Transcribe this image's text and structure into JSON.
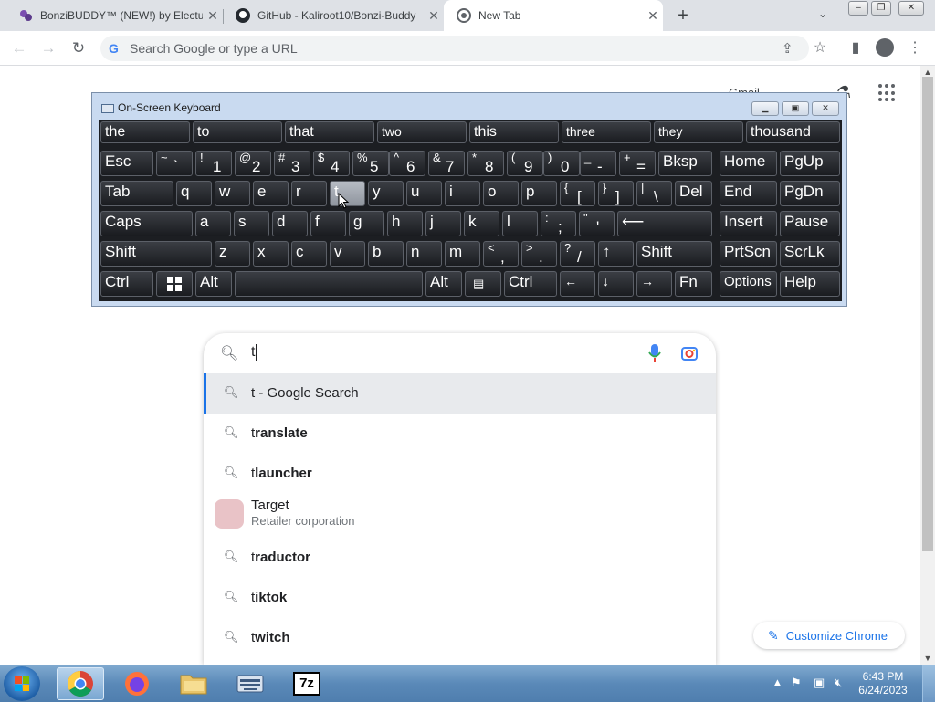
{
  "browser": {
    "tabs": [
      {
        "title": "BonziBUDDY™ (NEW!) by Electus"
      },
      {
        "title": "GitHub - Kaliroot10/Bonzi-Buddy"
      },
      {
        "title": "New Tab"
      }
    ],
    "new_tab": "+",
    "omnibox": {
      "placeholder": "Search Google or type a URL"
    }
  },
  "page": {
    "gmail_label": "Gmail",
    "search": {
      "query": "t",
      "suggestions": [
        {
          "text": "t - Google Search",
          "prefix": "t",
          "rest": " - Google Search"
        },
        {
          "text": "translate",
          "prefix": "t",
          "rest": "ranslate"
        },
        {
          "text": "tlauncher",
          "prefix": "t",
          "rest": "launcher"
        },
        {
          "title": "Target",
          "subtitle": "Retailer corporation"
        },
        {
          "text": "traductor",
          "prefix": "t",
          "rest": "raductor"
        },
        {
          "text": "tiktok",
          "prefix": "t",
          "rest": "iktok"
        },
        {
          "text": "twitch",
          "prefix": "t",
          "rest": "witch"
        }
      ]
    },
    "customize_label": "Customize Chrome"
  },
  "osk": {
    "title": "On-Screen Keyboard",
    "predictions": [
      "the",
      "to",
      "that",
      "two",
      "this",
      "three",
      "they",
      "thousand"
    ],
    "row1": {
      "esc": "Esc",
      "sym": [
        {
          "s": "~",
          "m": "`"
        },
        {
          "s": "!",
          "m": "1"
        },
        {
          "s": "@",
          "m": "2"
        },
        {
          "s": "#",
          "m": "3"
        },
        {
          "s": "$",
          "m": "4"
        },
        {
          "s": "%",
          "m": "5"
        },
        {
          "s": "^",
          "m": "6"
        },
        {
          "s": "&",
          "m": "7"
        },
        {
          "s": "*",
          "m": "8"
        },
        {
          "s": "(",
          "m": "9"
        },
        {
          "s": ")",
          "m": "0"
        },
        {
          "s": "_",
          "m": "-"
        },
        {
          "s": "+",
          "m": "="
        }
      ],
      "bksp": "Bksp",
      "home": "Home",
      "pgup": "PgUp"
    },
    "row2": {
      "tab": "Tab",
      "letters": [
        "q",
        "w",
        "e",
        "r",
        "t",
        "y",
        "u",
        "i",
        "o",
        "p"
      ],
      "brace_open": {
        "s": "{",
        "m": "["
      },
      "brace_close": {
        "s": "}",
        "m": "]"
      },
      "pipe": {
        "s": "|",
        "m": "\\"
      },
      "del": "Del",
      "end": "End",
      "pgdn": "PgDn"
    },
    "row3": {
      "caps": "Caps",
      "letters": [
        "a",
        "s",
        "d",
        "f",
        "g",
        "h",
        "j",
        "k",
        "l"
      ],
      "colon": {
        "s": ":",
        "m": ";"
      },
      "quote": {
        "s": "\"",
        "m": "'"
      },
      "enter": "⟵",
      "insert": "Insert",
      "pause": "Pause"
    },
    "row4": {
      "shift_l": "Shift",
      "letters": [
        "z",
        "x",
        "c",
        "v",
        "b",
        "n",
        "m"
      ],
      "lt": {
        "s": "<",
        "m": ","
      },
      "gt": {
        "s": ">",
        "m": "."
      },
      "qm": {
        "s": "?",
        "m": "/"
      },
      "up": "↑",
      "shift_r": "Shift",
      "prtscn": "PrtScn",
      "scrlk": "ScrLk"
    },
    "row5": {
      "ctrl_l": "Ctrl",
      "alt_l": "Alt",
      "alt_r": "Alt",
      "ctrl_r": "Ctrl",
      "left": "←",
      "down": "↓",
      "right": "→",
      "fn": "Fn",
      "options": "Options",
      "help": "Help"
    }
  },
  "taskbar": {
    "time": "6:43 PM",
    "date": "6/24/2023",
    "sevenzip_label": "7z"
  },
  "colors": {
    "accent": "#1a73e8",
    "taskbar": "#5a89b8"
  }
}
